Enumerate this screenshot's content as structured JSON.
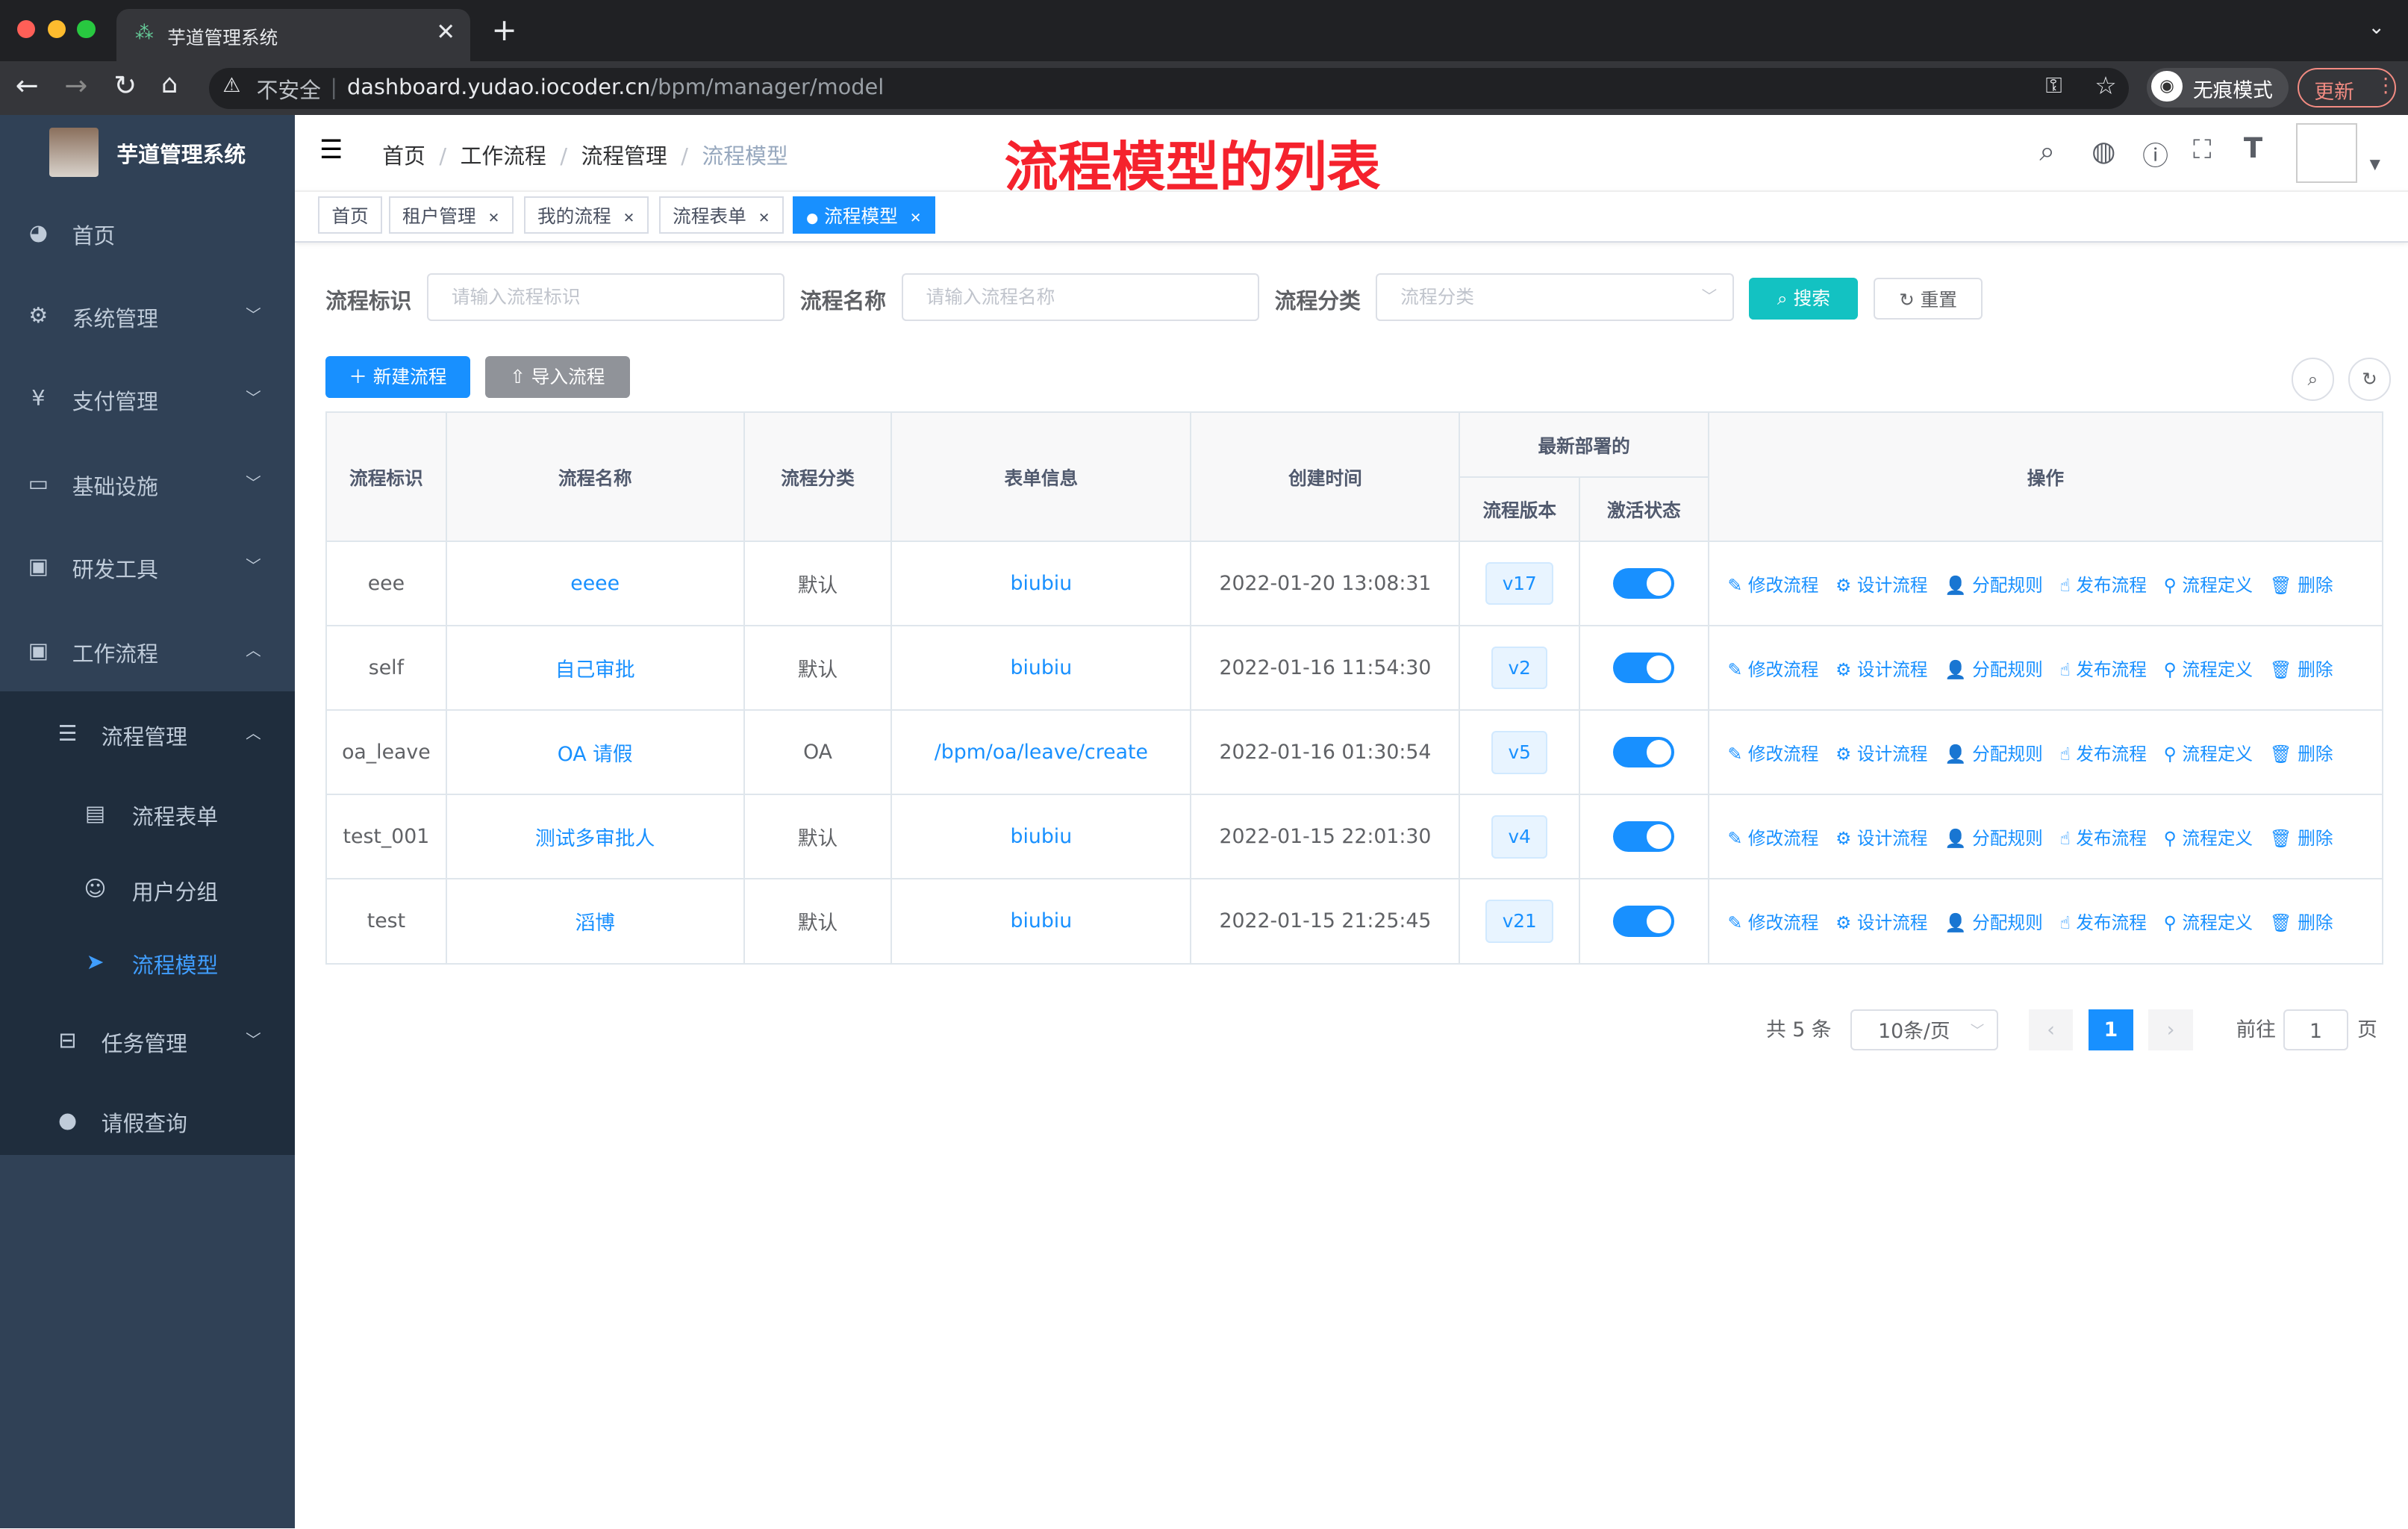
{
  "browser": {
    "tab_title": "芋道管理系统",
    "insecure_label": "不安全",
    "url_host": "dashboard.yudao.iocoder.cn",
    "url_path": "/bpm/manager/model",
    "incognito": "无痕模式",
    "update": "更新"
  },
  "sidebar": {
    "logo_title": "芋道管理系统",
    "items": [
      {
        "label": "首页",
        "icon": "dashboard-icon"
      },
      {
        "label": "系统管理",
        "icon": "gear-icon"
      },
      {
        "label": "支付管理",
        "icon": "yen-icon"
      },
      {
        "label": "基础设施",
        "icon": "monitor-icon"
      },
      {
        "label": "研发工具",
        "icon": "toolbox-icon"
      },
      {
        "label": "工作流程",
        "icon": "toolbox-icon"
      },
      {
        "label": "流程管理",
        "icon": "list-icon"
      },
      {
        "label": "流程表单",
        "icon": "form-icon"
      },
      {
        "label": "用户分组",
        "icon": "group-icon"
      },
      {
        "label": "流程模型",
        "icon": "send-icon"
      },
      {
        "label": "任务管理",
        "icon": "task-icon"
      },
      {
        "label": "请假查询",
        "icon": "user-icon"
      }
    ]
  },
  "breadcrumb": [
    "首页",
    "工作流程",
    "流程管理",
    "流程模型"
  ],
  "annotation": "流程模型的列表",
  "tags": [
    "首页",
    "租户管理",
    "我的流程",
    "流程表单",
    "流程模型"
  ],
  "search": {
    "key_label": "流程标识",
    "key_placeholder": "请输入流程标识",
    "name_label": "流程名称",
    "name_placeholder": "请输入流程名称",
    "category_label": "流程分类",
    "category_placeholder": "流程分类",
    "search_btn": "搜索",
    "reset_btn": "重置"
  },
  "toolbar": {
    "create": "新建流程",
    "import": "导入流程"
  },
  "table": {
    "headers": {
      "key": "流程标识",
      "name": "流程名称",
      "category": "流程分类",
      "form": "表单信息",
      "created": "创建时间",
      "deploy_group": "最新部署的",
      "version": "流程版本",
      "status": "激活状态",
      "actions": "操作"
    },
    "actions": [
      "修改流程",
      "设计流程",
      "分配规则",
      "发布流程",
      "流程定义",
      "删除"
    ],
    "rows": [
      {
        "key": "eee",
        "name": "eeee",
        "category": "默认",
        "form": "biubiu",
        "created": "2022-01-20 13:08:31",
        "version": "v17",
        "active": true
      },
      {
        "key": "self",
        "name": "自己审批",
        "category": "默认",
        "form": "biubiu",
        "created": "2022-01-16 11:54:30",
        "version": "v2",
        "active": true
      },
      {
        "key": "oa_leave",
        "name": "OA 请假",
        "category": "OA",
        "form": "/bpm/oa/leave/create",
        "created": "2022-01-16 01:30:54",
        "version": "v5",
        "active": true
      },
      {
        "key": "test_001",
        "name": "测试多审批人",
        "category": "默认",
        "form": "biubiu",
        "created": "2022-01-15 22:01:30",
        "version": "v4",
        "active": true
      },
      {
        "key": "test",
        "name": "滔博",
        "category": "默认",
        "form": "biubiu",
        "created": "2022-01-15 21:25:45",
        "version": "v21",
        "active": true
      }
    ]
  },
  "pagination": {
    "total": "共 5 条",
    "page_size": "10条/页",
    "current": "1",
    "goto": "前往",
    "goto_value": "1",
    "page_suffix": "页"
  }
}
